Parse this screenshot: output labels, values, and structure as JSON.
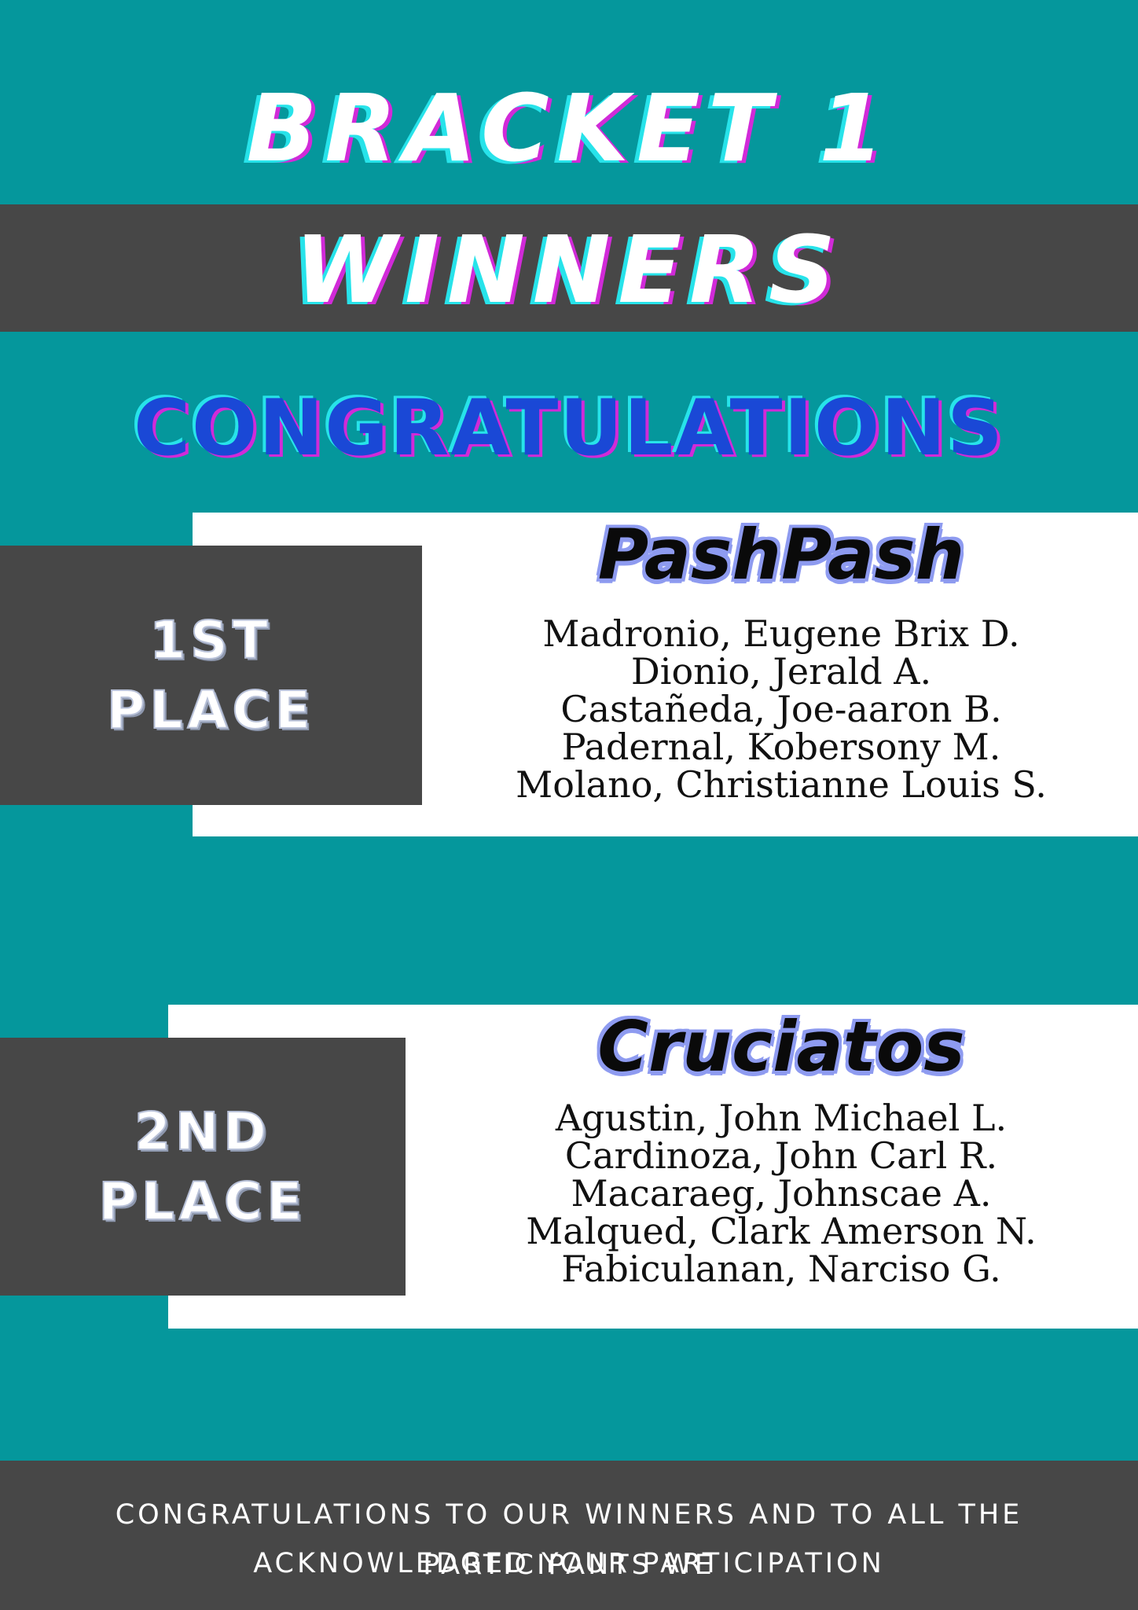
{
  "title": {
    "line1": "BRACKET 1",
    "line2": "WINNERS"
  },
  "congratulations": "CONGRATULATIONS",
  "places": [
    {
      "label_line1": "1ST",
      "label_line2": "PLACE",
      "team": "PashPash",
      "members": [
        "Madronio, Eugene Brix D.",
        "Dionio, Jerald A.",
        "Castañeda, Joe-aaron B.",
        "Padernal, Kobersony M.",
        "Molano, Christianne Louis S."
      ]
    },
    {
      "label_line1": "2ND",
      "label_line2": "PLACE",
      "team": "Cruciatos",
      "members": [
        "Agustin, John Michael L.",
        "Cardinoza, John Carl R.",
        "Macaraeg, Johnscae A.",
        "Malqued, Clark Amerson N.",
        "Fabiculanan, Narciso G."
      ]
    }
  ],
  "footer": {
    "line1": "CONGRATULATIONS TO OUR WINNERS AND TO ALL THE PARTICIPANTS WE",
    "line2": "ACKNOWLEDGED YOUR PARTICIPATION"
  },
  "colors": {
    "teal_background": "#05979c",
    "dark_band": "#474747",
    "congrats_blue": "#1a48d6",
    "team_outline": "#8e9bf0"
  }
}
